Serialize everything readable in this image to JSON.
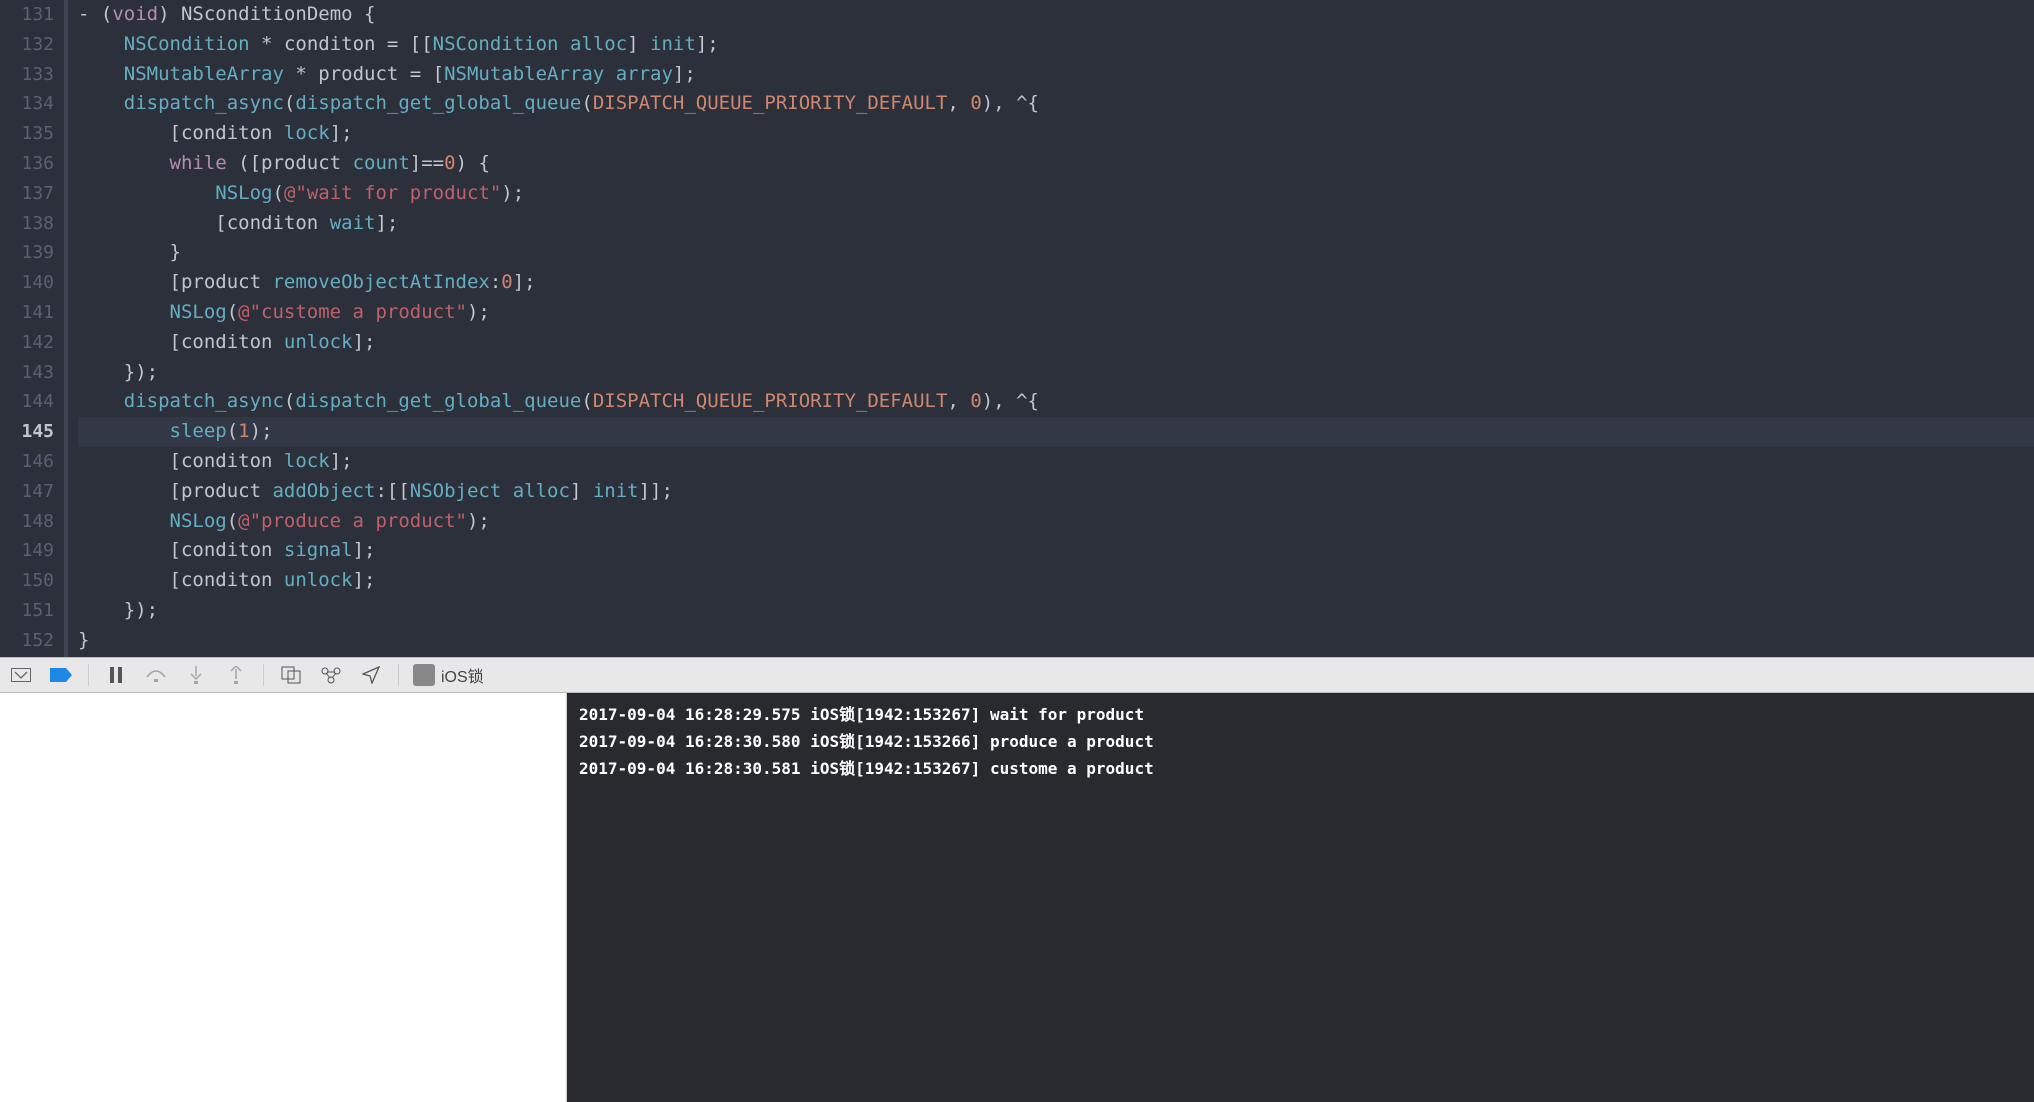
{
  "gutter": {
    "start": 131,
    "end": 152,
    "active": 145
  },
  "code": {
    "lines": [
      {
        "n": 131,
        "segs": [
          [
            "c-white",
            "- ("
          ],
          [
            "c-keyword",
            "void"
          ],
          [
            "c-white",
            ") "
          ],
          [
            "c-var",
            "NSconditionDemo"
          ],
          [
            "c-white",
            " {"
          ]
        ]
      },
      {
        "n": 132,
        "segs": [
          [
            "c-white",
            "    "
          ],
          [
            "c-type",
            "NSCondition"
          ],
          [
            "c-white",
            " * "
          ],
          [
            "c-var",
            "conditon"
          ],
          [
            "c-white",
            " = [["
          ],
          [
            "c-type",
            "NSCondition"
          ],
          [
            "c-white",
            " "
          ],
          [
            "c-method",
            "alloc"
          ],
          [
            "c-white",
            "] "
          ],
          [
            "c-method",
            "init"
          ],
          [
            "c-white",
            "];"
          ]
        ]
      },
      {
        "n": 133,
        "segs": [
          [
            "c-white",
            "    "
          ],
          [
            "c-type",
            "NSMutableArray"
          ],
          [
            "c-white",
            " * "
          ],
          [
            "c-var",
            "product"
          ],
          [
            "c-white",
            " = ["
          ],
          [
            "c-type",
            "NSMutableArray"
          ],
          [
            "c-white",
            " "
          ],
          [
            "c-method",
            "array"
          ],
          [
            "c-white",
            "];"
          ]
        ]
      },
      {
        "n": 134,
        "segs": [
          [
            "c-white",
            "    "
          ],
          [
            "c-func",
            "dispatch_async"
          ],
          [
            "c-white",
            "("
          ],
          [
            "c-func",
            "dispatch_get_global_queue"
          ],
          [
            "c-white",
            "("
          ],
          [
            "c-const",
            "DISPATCH_QUEUE_PRIORITY_DEFAULT"
          ],
          [
            "c-white",
            ", "
          ],
          [
            "c-num",
            "0"
          ],
          [
            "c-white",
            "), ^{"
          ]
        ]
      },
      {
        "n": 135,
        "segs": [
          [
            "c-white",
            "        ["
          ],
          [
            "c-var",
            "conditon"
          ],
          [
            "c-white",
            " "
          ],
          [
            "c-method",
            "lock"
          ],
          [
            "c-white",
            "];"
          ]
        ]
      },
      {
        "n": 136,
        "segs": [
          [
            "c-white",
            "        "
          ],
          [
            "c-keyword",
            "while"
          ],
          [
            "c-white",
            " (["
          ],
          [
            "c-var",
            "product"
          ],
          [
            "c-white",
            " "
          ],
          [
            "c-method",
            "count"
          ],
          [
            "c-white",
            "]=="
          ],
          [
            "c-num",
            "0"
          ],
          [
            "c-white",
            ") {"
          ]
        ]
      },
      {
        "n": 137,
        "segs": [
          [
            "c-white",
            "            "
          ],
          [
            "c-func",
            "NSLog"
          ],
          [
            "c-white",
            "("
          ],
          [
            "c-string-at",
            "@\"wait for product\""
          ],
          [
            "c-white",
            ");"
          ]
        ]
      },
      {
        "n": 138,
        "segs": [
          [
            "c-white",
            "            ["
          ],
          [
            "c-var",
            "conditon"
          ],
          [
            "c-white",
            " "
          ],
          [
            "c-method",
            "wait"
          ],
          [
            "c-white",
            "];"
          ]
        ]
      },
      {
        "n": 139,
        "segs": [
          [
            "c-white",
            "        }"
          ]
        ]
      },
      {
        "n": 140,
        "segs": [
          [
            "c-white",
            "        ["
          ],
          [
            "c-var",
            "product"
          ],
          [
            "c-white",
            " "
          ],
          [
            "c-method",
            "removeObjectAtIndex"
          ],
          [
            "c-white",
            ":"
          ],
          [
            "c-num",
            "0"
          ],
          [
            "c-white",
            "];"
          ]
        ]
      },
      {
        "n": 141,
        "segs": [
          [
            "c-white",
            "        "
          ],
          [
            "c-func",
            "NSLog"
          ],
          [
            "c-white",
            "("
          ],
          [
            "c-string-at",
            "@\"custome a product\""
          ],
          [
            "c-white",
            ");"
          ]
        ]
      },
      {
        "n": 142,
        "segs": [
          [
            "c-white",
            "        ["
          ],
          [
            "c-var",
            "conditon"
          ],
          [
            "c-white",
            " "
          ],
          [
            "c-method",
            "unlock"
          ],
          [
            "c-white",
            "];"
          ]
        ]
      },
      {
        "n": 143,
        "segs": [
          [
            "c-white",
            "    });"
          ]
        ]
      },
      {
        "n": 144,
        "segs": [
          [
            "c-white",
            "    "
          ],
          [
            "c-func",
            "dispatch_async"
          ],
          [
            "c-white",
            "("
          ],
          [
            "c-func",
            "dispatch_get_global_queue"
          ],
          [
            "c-white",
            "("
          ],
          [
            "c-const",
            "DISPATCH_QUEUE_PRIORITY_DEFAULT"
          ],
          [
            "c-white",
            ", "
          ],
          [
            "c-num",
            "0"
          ],
          [
            "c-white",
            "), ^{"
          ]
        ]
      },
      {
        "n": 145,
        "segs": [
          [
            "c-white",
            "        "
          ],
          [
            "c-func",
            "sleep"
          ],
          [
            "c-white",
            "("
          ],
          [
            "c-num",
            "1"
          ],
          [
            "c-white",
            ");"
          ]
        ]
      },
      {
        "n": 146,
        "segs": [
          [
            "c-white",
            "        ["
          ],
          [
            "c-var",
            "conditon"
          ],
          [
            "c-white",
            " "
          ],
          [
            "c-method",
            "lock"
          ],
          [
            "c-white",
            "];"
          ]
        ]
      },
      {
        "n": 147,
        "segs": [
          [
            "c-white",
            "        ["
          ],
          [
            "c-var",
            "product"
          ],
          [
            "c-white",
            " "
          ],
          [
            "c-method",
            "addObject"
          ],
          [
            "c-white",
            ":[["
          ],
          [
            "c-type",
            "NSObject"
          ],
          [
            "c-white",
            " "
          ],
          [
            "c-method",
            "alloc"
          ],
          [
            "c-white",
            "] "
          ],
          [
            "c-method",
            "init"
          ],
          [
            "c-white",
            "]];"
          ]
        ]
      },
      {
        "n": 148,
        "segs": [
          [
            "c-white",
            "        "
          ],
          [
            "c-func",
            "NSLog"
          ],
          [
            "c-white",
            "("
          ],
          [
            "c-string-at",
            "@\"produce a product\""
          ],
          [
            "c-white",
            ");"
          ]
        ]
      },
      {
        "n": 149,
        "segs": [
          [
            "c-white",
            "        ["
          ],
          [
            "c-var",
            "conditon"
          ],
          [
            "c-white",
            " "
          ],
          [
            "c-method",
            "signal"
          ],
          [
            "c-white",
            "];"
          ]
        ]
      },
      {
        "n": 150,
        "segs": [
          [
            "c-white",
            "        ["
          ],
          [
            "c-var",
            "conditon"
          ],
          [
            "c-white",
            " "
          ],
          [
            "c-method",
            "unlock"
          ],
          [
            "c-white",
            "];"
          ]
        ]
      },
      {
        "n": 151,
        "segs": [
          [
            "c-white",
            "    });"
          ]
        ]
      },
      {
        "n": 152,
        "segs": [
          [
            "c-white",
            "}"
          ]
        ]
      }
    ]
  },
  "debugbar": {
    "target_name": "iOS锁"
  },
  "console": {
    "lines": [
      "2017-09-04 16:28:29.575 iOS锁[1942:153267] wait for product",
      "2017-09-04 16:28:30.580 iOS锁[1942:153266] produce a product",
      "2017-09-04 16:28:30.581 iOS锁[1942:153267] custome a product"
    ]
  }
}
